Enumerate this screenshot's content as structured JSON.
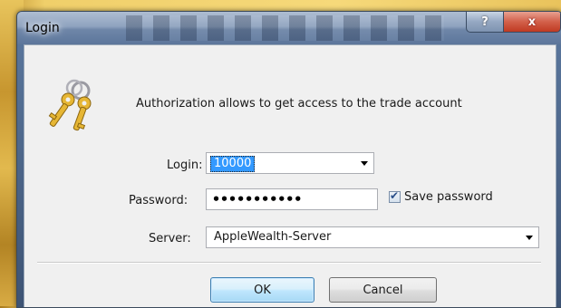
{
  "window": {
    "title": "Login",
    "help_label": "?",
    "close_label": "x"
  },
  "dialog": {
    "authorization_text": "Authorization allows to get access to the trade account",
    "login_label": "Login:",
    "login_value": "10000",
    "password_label": "Password:",
    "password_value": "•••••••••••",
    "save_password_label": "Save password",
    "save_password_checked": true,
    "server_label": "Server:",
    "server_value": "AppleWealth-Server",
    "ok_label": "OK",
    "cancel_label": "Cancel"
  },
  "icons": {
    "dialog_icon": "keys-icon",
    "combo_arrow": "chevron-down-icon",
    "checkbox_mark": "checkmark-icon"
  },
  "colors": {
    "selection": "#3399ff",
    "close_button": "#c03a22",
    "ok_button_border": "#3c7fb1",
    "background_accent": "#f6d97a"
  }
}
